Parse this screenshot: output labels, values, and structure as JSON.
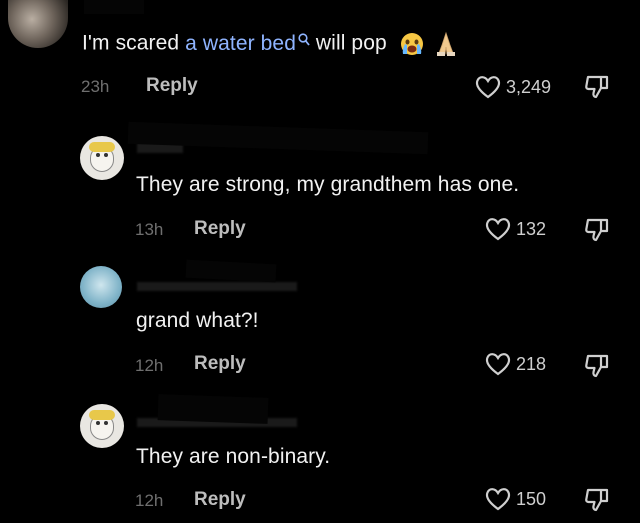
{
  "comments": [
    {
      "text_before": "I'm scared ",
      "link_text": "a water bed",
      "text_after": " will pop",
      "emojis": [
        "crying-face",
        "folded-hands"
      ],
      "time": "23h",
      "reply": "Reply",
      "likes": "3,249"
    },
    {
      "text": "They are strong, my grandthem has one.",
      "time": "13h",
      "reply": "Reply",
      "likes": "132"
    },
    {
      "text": "grand what?!",
      "time": "12h",
      "reply": "Reply",
      "likes": "218"
    },
    {
      "text": "They are non-binary.",
      "time": "12h",
      "reply": "Reply",
      "likes": "150"
    }
  ],
  "colors": {
    "background": "#000000",
    "text": "#f2f2f2",
    "link": "#8fb4ff",
    "meta": "#6f6f6f"
  },
  "icons": [
    "heart-outline-icon",
    "thumbs-down-icon",
    "search-icon"
  ]
}
